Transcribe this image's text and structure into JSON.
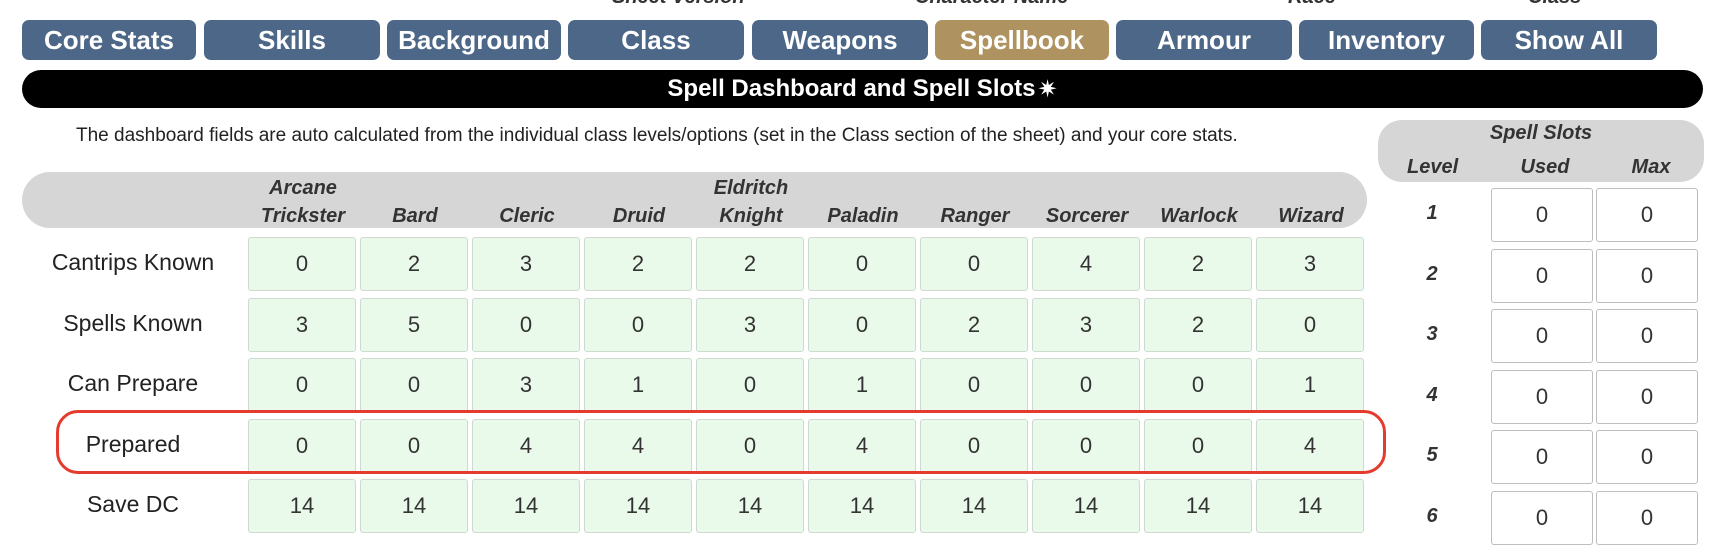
{
  "top_labels": [
    "Sheet Version",
    "Character Name",
    "Race",
    "Class"
  ],
  "nav": {
    "tabs": [
      {
        "label": "Core Stats"
      },
      {
        "label": "Skills"
      },
      {
        "label": "Background"
      },
      {
        "label": "Class"
      },
      {
        "label": "Weapons"
      },
      {
        "label": "Spellbook",
        "active": true
      },
      {
        "label": "Armour"
      },
      {
        "label": "Inventory"
      },
      {
        "label": "Show All"
      }
    ]
  },
  "banner": {
    "title": "Spell Dashboard and Spell Slots",
    "icon": "sparkle-burst-icon"
  },
  "info_text": "The dashboard fields are auto calculated from the individual class levels/options (set in the Class section of the sheet) and your core stats.",
  "dashboard": {
    "columns": [
      {
        "line1": "Arcane",
        "line2": "Trickster"
      },
      {
        "line1": "",
        "line2": "Bard"
      },
      {
        "line1": "",
        "line2": "Cleric"
      },
      {
        "line1": "",
        "line2": "Druid"
      },
      {
        "line1": "Eldritch",
        "line2": "Knight"
      },
      {
        "line1": "",
        "line2": "Paladin"
      },
      {
        "line1": "",
        "line2": "Ranger"
      },
      {
        "line1": "",
        "line2": "Sorcerer"
      },
      {
        "line1": "",
        "line2": "Warlock"
      },
      {
        "line1": "",
        "line2": "Wizard"
      }
    ],
    "rows": [
      {
        "label": "Cantrips Known",
        "values": [
          "0",
          "2",
          "3",
          "2",
          "2",
          "0",
          "0",
          "4",
          "2",
          "3"
        ]
      },
      {
        "label": "Spells Known",
        "values": [
          "3",
          "5",
          "0",
          "0",
          "3",
          "0",
          "2",
          "3",
          "2",
          "0"
        ]
      },
      {
        "label": "Can Prepare",
        "values": [
          "0",
          "0",
          "3",
          "1",
          "0",
          "1",
          "0",
          "0",
          "0",
          "1"
        ]
      },
      {
        "label": "Prepared",
        "values": [
          "0",
          "0",
          "4",
          "4",
          "0",
          "4",
          "0",
          "0",
          "0",
          "4"
        ]
      },
      {
        "label": "Save DC",
        "values": [
          "14",
          "14",
          "14",
          "14",
          "14",
          "14",
          "14",
          "14",
          "14",
          "14"
        ]
      }
    ]
  },
  "spell_slots": {
    "title": "Spell Slots",
    "headers": {
      "level": "Level",
      "used": "Used",
      "max": "Max"
    },
    "levels": [
      {
        "level": "1",
        "used": "0",
        "max": "0"
      },
      {
        "level": "2",
        "used": "0",
        "max": "0"
      },
      {
        "level": "3",
        "used": "0",
        "max": "0"
      },
      {
        "level": "4",
        "used": "0",
        "max": "0"
      },
      {
        "level": "5",
        "used": "0",
        "max": "0"
      },
      {
        "level": "6",
        "used": "0",
        "max": "0"
      }
    ]
  },
  "colors": {
    "tab": "#4d6788",
    "tab_active": "#ae9360",
    "cell": "#e9faeb",
    "highlight": "#e53b2f"
  }
}
